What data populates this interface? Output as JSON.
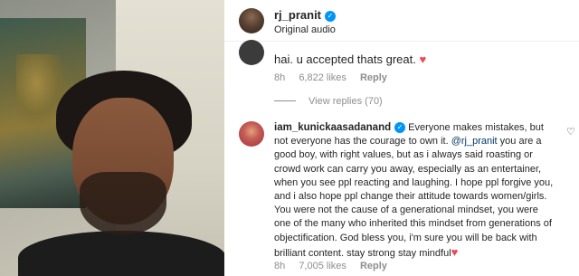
{
  "header": {
    "username": "rj_pranit",
    "subtitle": "Original audio"
  },
  "comment1": {
    "text": "hai. u accepted thats great.",
    "time": "8h",
    "likes": "6,822 likes",
    "reply": "Reply"
  },
  "view_replies": "View replies (70)",
  "comment2": {
    "username": "iam_kunickaasadanand",
    "text_before_mention": " Everyone makes mistakes, but not everyone has the courage to own it. ",
    "mention": "@rj_pranit",
    "text_after_mention": " you are a good boy, with right values, but as i always said roasting or crowd work can carry you away, especially as an entertainer, when you see ppl reacting and laughing. I hope ppl forgive you, and i also hope ppl change their attitude towards women/girls. You were not the cause of a generational mindset, you were one of the many who inherited this mindset from generations of objectification. God bless you, i'm sure you will be back with brilliant content. stay strong stay mindful",
    "time": "8h",
    "likes": "7,005 likes",
    "reply": "Reply"
  },
  "colors": {
    "verified": "#0095f6",
    "heart": "#ed4956",
    "mention": "#00376b",
    "muted": "#8e8e8e"
  },
  "icons": {
    "verified": "verified-badge-icon",
    "heart": "heart-emoji-icon",
    "like": "heart-outline-icon"
  }
}
